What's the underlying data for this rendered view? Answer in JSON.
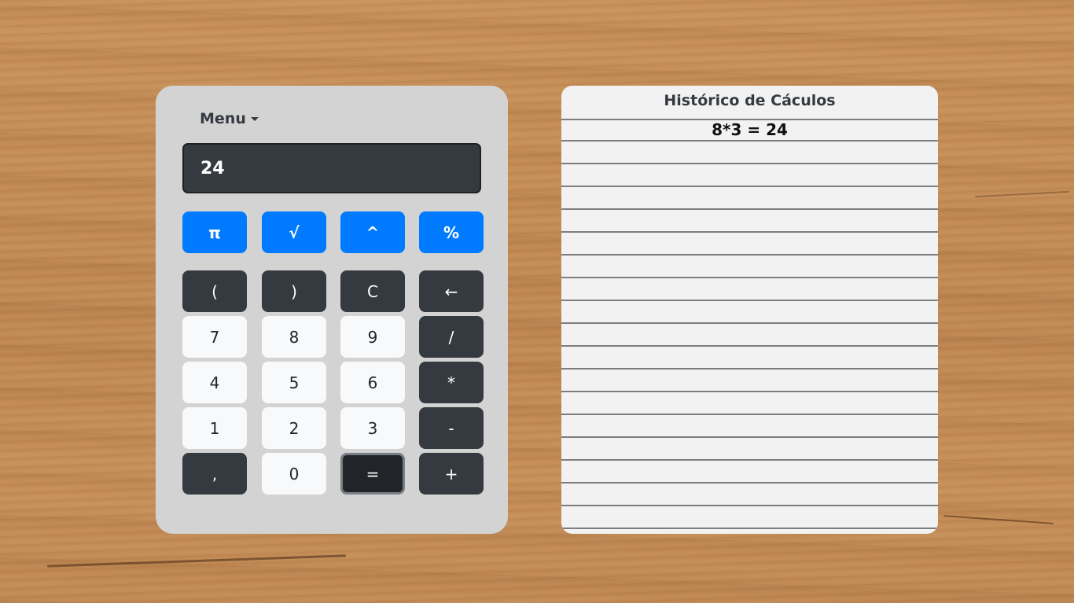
{
  "calculator": {
    "menu_label": "Menu",
    "display_value": "24",
    "function_buttons": [
      {
        "label": "π",
        "name": "pi-button"
      },
      {
        "label": "√",
        "name": "sqrt-button"
      },
      {
        "label": "^",
        "name": "power-button"
      },
      {
        "label": "%",
        "name": "percent-button"
      }
    ],
    "rows": [
      [
        {
          "label": "(",
          "name": "open-paren-button",
          "style": "dark"
        },
        {
          "label": ")",
          "name": "close-paren-button",
          "style": "dark"
        },
        {
          "label": "C",
          "name": "clear-button",
          "style": "dark"
        },
        {
          "label": "←",
          "name": "backspace-button",
          "style": "dark"
        }
      ],
      [
        {
          "label": "7",
          "name": "digit-7-button",
          "style": "light"
        },
        {
          "label": "8",
          "name": "digit-8-button",
          "style": "light"
        },
        {
          "label": "9",
          "name": "digit-9-button",
          "style": "light"
        },
        {
          "label": "/",
          "name": "divide-button",
          "style": "dark"
        }
      ],
      [
        {
          "label": "4",
          "name": "digit-4-button",
          "style": "light"
        },
        {
          "label": "5",
          "name": "digit-5-button",
          "style": "light"
        },
        {
          "label": "6",
          "name": "digit-6-button",
          "style": "light"
        },
        {
          "label": "*",
          "name": "multiply-button",
          "style": "dark"
        }
      ],
      [
        {
          "label": "1",
          "name": "digit-1-button",
          "style": "light"
        },
        {
          "label": "2",
          "name": "digit-2-button",
          "style": "light"
        },
        {
          "label": "3",
          "name": "digit-3-button",
          "style": "light"
        },
        {
          "label": "-",
          "name": "subtract-button",
          "style": "dark"
        }
      ],
      [
        {
          "label": ",",
          "name": "decimal-comma-button",
          "style": "dark"
        },
        {
          "label": "0",
          "name": "digit-0-button",
          "style": "light"
        },
        {
          "label": "=",
          "name": "equals-button",
          "style": "eq"
        },
        {
          "label": "+",
          "name": "add-button",
          "style": "dark"
        }
      ]
    ]
  },
  "history": {
    "title": "Histórico de Cáculos",
    "entries": [
      "8*3 = 24"
    ]
  },
  "colors": {
    "primary_blue": "#007bff",
    "dark_button": "#343a40",
    "light_button": "#f8f9fa",
    "calculator_body": "#d3d3d3",
    "history_paper": "#f2f2f2"
  }
}
